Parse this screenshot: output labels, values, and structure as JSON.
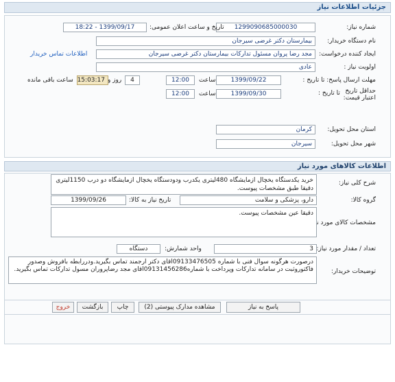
{
  "page_title": "جزئيات اطلاعات نياز",
  "details": {
    "need_number_label": "شماره نياز:",
    "need_number": "1299090685000030",
    "announce_label": "تاريخ و ساعت اعلان عمومی:",
    "announce_value": "1399/09/17 - 18:22",
    "buyer_label": "نام دستگاه خريدار:",
    "buyer": "بیمارستان دکتر غرضی سیرجان",
    "creator_label": "ايجاد کننده درخواست:",
    "creator": "مجد رضا پروان مسئول تدارکات بیمارستان دکتر غرضی سیرجان",
    "contact_link": "اطلاعات تماس خريدار",
    "priority_label": "اولويت نياز :",
    "priority": "عادی",
    "reply_deadline_label": "مهلت ارسال پاسخ: تا تاريخ :",
    "reply_date": "1399/09/22",
    "time_label": "ساعت",
    "reply_time": "12:00",
    "days_value": "4",
    "days_label": "روز و",
    "remaining_time": "15:03:17",
    "remaining_label": "ساعت باقی مانده",
    "min_validity_label": "حداقل تاريخ اعتبار قيمت:",
    "until_date_label": "تا تاريخ :",
    "validity_date": "1399/09/30",
    "validity_time": "12:00",
    "province_label": "استان محل تحويل:",
    "province": "کرمان",
    "city_label": "شهر محل تحويل:",
    "city": "سیرجان"
  },
  "goods": {
    "section_title": "اطلاعات کالاهای مورد نياز",
    "description_label": "شرح کلی نياز:",
    "description": "خرید یکدستگاه یخچال ازمایشگاه 480لیتری یکدرب ودودستگاه یخچال ازمایشگاه دو درب 1150لیتری دقیقا طبق مشخصات پیوست.",
    "group_label": "گروه کالا:",
    "group": "دارو، پزشکی و سلامت",
    "need_date_label": "تاريخ نياز به کالا:",
    "need_date": "1399/09/26",
    "specs_label": "مشخصات کالای مورد نياز:",
    "specs": "دقیقا عین مشخصات پیوست.",
    "qty_label": "تعداد / مقدار مورد نياز:",
    "qty": "3",
    "unit_label": "واحد شمارش:",
    "unit": "دستگاه",
    "buyer_notes_label": "توضيحات خريدار:",
    "buyer_notes": "درصورت هرگونه سوال فنی با شماره 09133476505اقای دکتر ارجمند تماس بگیرید.ودررابطه بافروش وصدور فاکتوروثبت در سامانه تدارکات وپرداخت با شماره09131456286اقای مجد رضاپروران مسول تدارکات تماس بگیرید."
  },
  "buttons": {
    "reply": "پاسخ به نياز",
    "attachments": "مشاهده مدارک پيوستی (2)",
    "print": "چاپ",
    "back": "بازگشت",
    "exit": "خروج"
  }
}
